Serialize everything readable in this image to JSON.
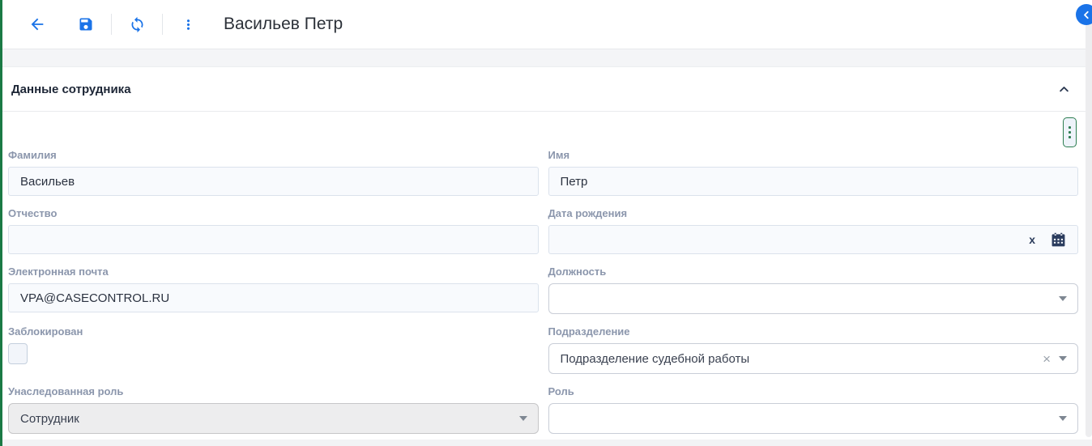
{
  "toolbar": {
    "title": "Васильев Петр",
    "icons": {
      "back": "arrow-left-icon",
      "save": "floppy-disk-icon",
      "refresh": "sync-icon",
      "more": "more-vert-icon"
    }
  },
  "panel_toggle": {
    "icon": "chevron-left-icon"
  },
  "section": {
    "title": "Данные сотрудника",
    "collapse_icon": "chevron-up-icon",
    "kebab_icon": "more-vert-icon"
  },
  "form": {
    "last_name": {
      "label": "Фамилия",
      "value": "Васильев"
    },
    "first_name": {
      "label": "Имя",
      "value": "Петр"
    },
    "middle_name": {
      "label": "Отчество",
      "value": ""
    },
    "birth_date": {
      "label": "Дата рождения",
      "value": "",
      "clear_glyph": "x",
      "calendar_icon": "calendar-icon"
    },
    "email": {
      "label": "Электронная почта",
      "value": "VPA@CASECONTROL.RU"
    },
    "position": {
      "label": "Должность",
      "value": ""
    },
    "blocked": {
      "label": "Заблокирован",
      "checked": false
    },
    "department": {
      "label": "Подразделение",
      "value": "Подразделение судебной работы",
      "clear_glyph": "×"
    },
    "inherited_role": {
      "label": "Унаследованная роль",
      "value": "Сотрудник",
      "disabled": true
    },
    "role": {
      "label": "Роль",
      "value": ""
    }
  },
  "colors": {
    "accent_blue": "#1a73e8",
    "green_edge": "#1b7a45",
    "kebab_green": "#2c7d50",
    "label_gray_blue": "#8b96ac"
  }
}
